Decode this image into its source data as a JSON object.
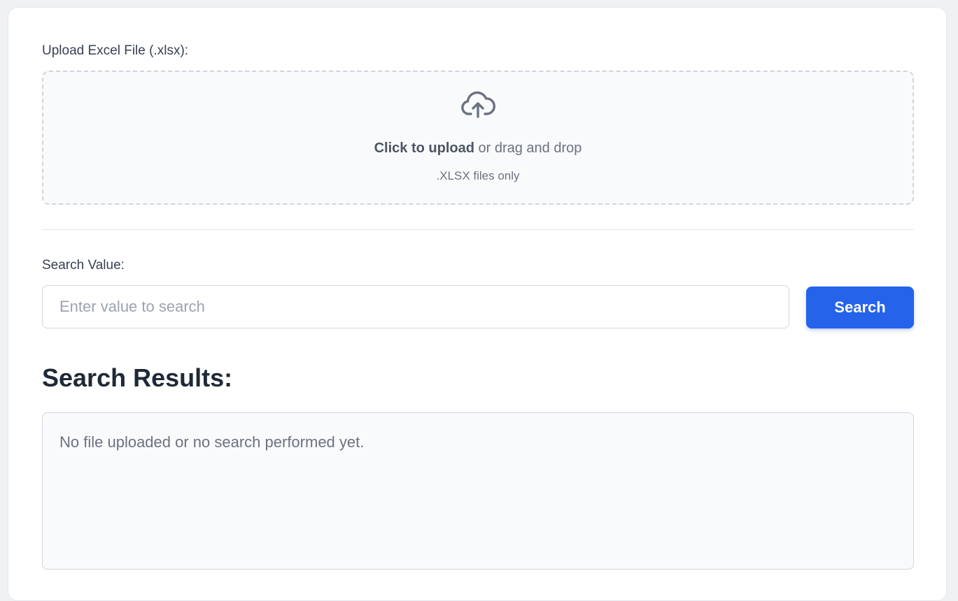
{
  "upload": {
    "label": "Upload Excel File (.xlsx):",
    "cta_strong": "Click to upload",
    "cta_rest": " or drag and drop",
    "hint": ".XLSX files only",
    "icon": "cloud-upload-icon"
  },
  "search": {
    "label": "Search Value:",
    "placeholder": "Enter value to search",
    "value": "",
    "button_label": "Search"
  },
  "results": {
    "title": "Search Results:",
    "empty_message": "No file uploaded or no search performed yet."
  },
  "colors": {
    "primary": "#2563eb",
    "page_background": "#f0f1f3",
    "card_background": "#ffffff",
    "muted_text": "#6b7280"
  }
}
